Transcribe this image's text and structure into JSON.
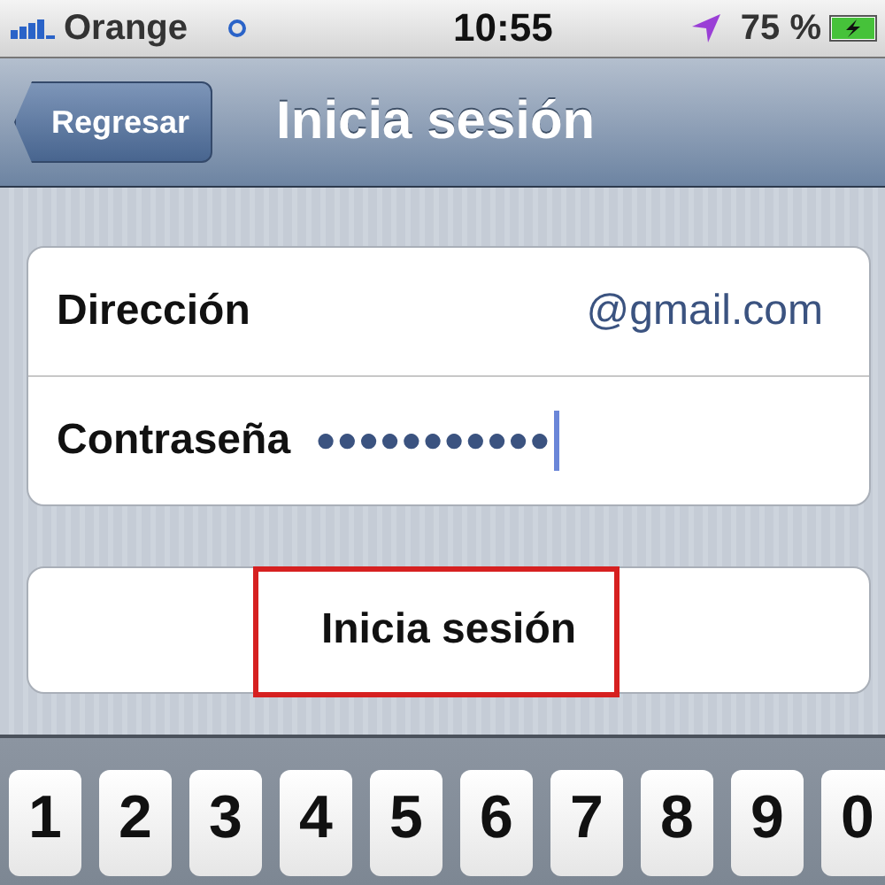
{
  "status_bar": {
    "carrier": "Orange",
    "time": "10:55",
    "battery": "75 %"
  },
  "nav_bar": {
    "back": "Regresar",
    "title": "Inicia sesión"
  },
  "fields": [
    {
      "label": "Dirección",
      "value": "@gmail.com",
      "kind": "text"
    },
    {
      "label": "Contraseña",
      "value": "●●●●●●●●●●●",
      "kind": "password"
    }
  ],
  "button": {
    "label": "Inicia sesión",
    "highlighted": true
  },
  "keyboard": {
    "keys": [
      "1",
      "2",
      "3",
      "4",
      "5",
      "6",
      "7",
      "8",
      "9",
      "0"
    ]
  }
}
